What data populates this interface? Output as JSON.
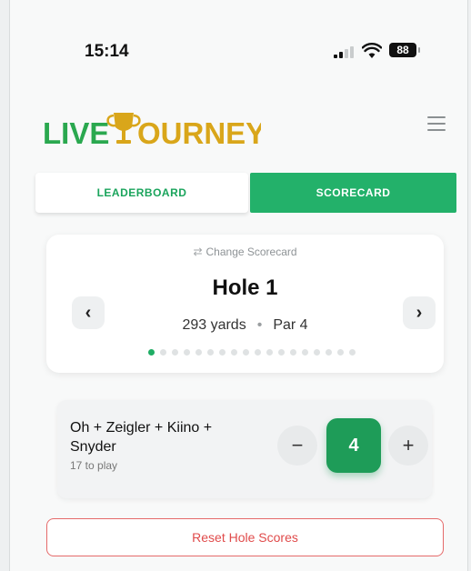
{
  "status_bar": {
    "time": "15:14",
    "battery": "88"
  },
  "header": {
    "logo_text": "LIVE TOURNEY",
    "menu_icon": "hamburger-icon"
  },
  "tabs": [
    {
      "label": "LEADERBOARD",
      "active": false
    },
    {
      "label": "SCORECARD",
      "active": true
    }
  ],
  "hole_card": {
    "change_label": "Change Scorecard",
    "title": "Hole 1",
    "yards": "293 yards",
    "separator": "•",
    "par": "Par 4",
    "total_holes": 18,
    "current_hole_index": 0
  },
  "team": {
    "name": "Oh + Zeigler + Kiino + Snyder",
    "sub": "17 to play",
    "score": "4",
    "minus_label": "−",
    "plus_label": "+"
  },
  "reset_label": "Reset Hole Scores",
  "colors": {
    "accent": "#23b16a",
    "score_bg": "#1e9c58",
    "danger": "#e04b4b",
    "logo_green": "#2aa84f",
    "logo_gold": "#d9a61a"
  }
}
